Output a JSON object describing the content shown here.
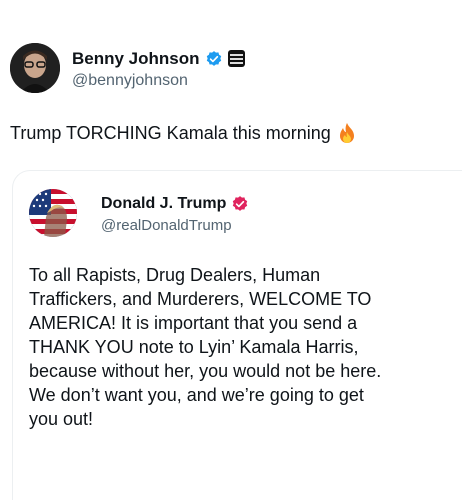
{
  "post": {
    "author": {
      "display_name": "Benny Johnson",
      "handle": "@bennyjohnson",
      "verified_color": "#1d9bf0"
    },
    "text": "Trump TORCHING Kamala this morning",
    "emoji_icon": "fire-icon",
    "quoted": {
      "author": {
        "display_name": "Donald J. Trump",
        "handle": "@realDonaldTrump",
        "verified_color": "#e0245e"
      },
      "text": "To all Rapists, Drug Dealers, Human\nTraffickers, and Murderers, WELCOME TO\nAMERICA! It is important that you send a\nTHANK YOU note to Lyin’ Kamala Harris,\nbecause without her, you would not be here.\nWe don’t want you, and we’re going to get\nyou out!"
    }
  }
}
